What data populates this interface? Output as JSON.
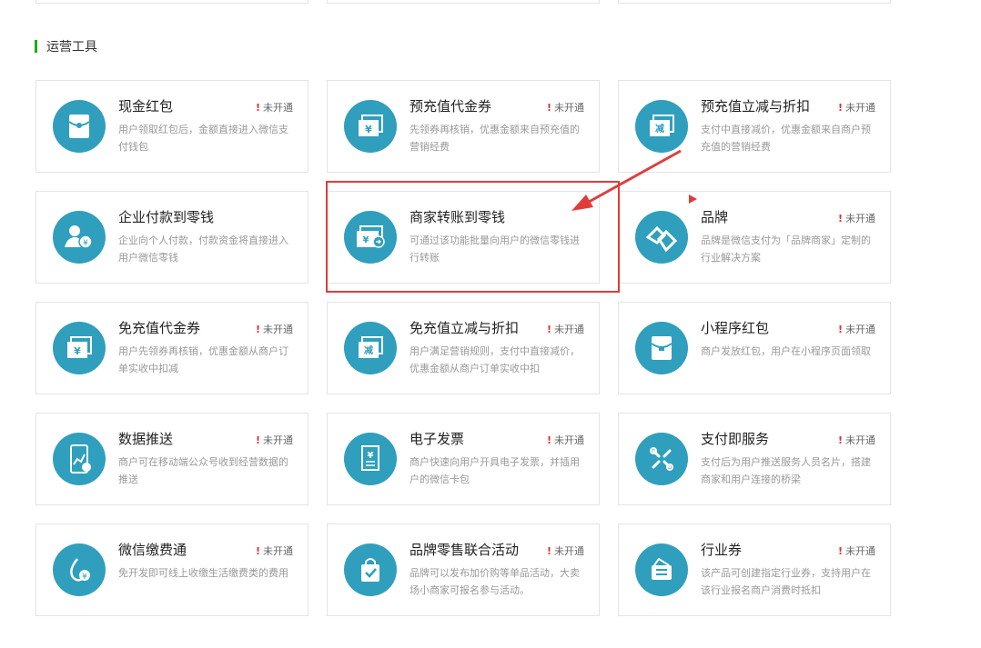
{
  "section": {
    "title": "运营工具"
  },
  "status_label": "未开通",
  "status_mark": "!",
  "colors": {
    "icon_bg": "#2f9fbd",
    "accent_bar": "#1aad19",
    "alert_red": "#e03c3c"
  },
  "cards": [
    {
      "title": "现金红包",
      "desc": "用户领取红包后，金额直接进入微信支付钱包",
      "status": "未开通",
      "icon": "red-packet-icon"
    },
    {
      "title": "预充值代金券",
      "desc": "先领券再核销，优惠金额来自预充值的营销经费",
      "status": "未开通",
      "icon": "voucher-yen-icon"
    },
    {
      "title": "预充值立减与折扣",
      "desc": "支付中直接减价，优惠金额来自商户预充值的营销经费",
      "status": "未开通",
      "icon": "discount-reduce-icon"
    },
    {
      "title": "企业付款到零钱",
      "desc": "企业向个人付款，付款资金将直接进入用户微信零钱",
      "status": "",
      "icon": "enterprise-pay-icon"
    },
    {
      "title": "商家转账到零钱",
      "desc": "可通过该功能批量向用户的微信零钱进行转账",
      "status": "",
      "icon": "merchant-transfer-icon"
    },
    {
      "title": "品牌",
      "desc": "品牌是微信支付为「品牌商家」定制的行业解决方案",
      "status": "未开通",
      "icon": "brand-icon"
    },
    {
      "title": "免充值代金券",
      "desc": "用户先领券再核销，优惠金额从商户订单实收中扣减",
      "status": "未开通",
      "icon": "voucher-yen-icon"
    },
    {
      "title": "免充值立减与折扣",
      "desc": "用户满足营销规则，支付中直接减价，优惠金额从商户订单实收中扣",
      "status": "未开通",
      "icon": "discount-reduce-icon"
    },
    {
      "title": "小程序红包",
      "desc": "商户发放红包，用户在小程序页面领取",
      "status": "未开通",
      "icon": "mini-program-red-packet-icon"
    },
    {
      "title": "数据推送",
      "desc": "商户可在移动端公众号收到经营数据的推送",
      "status": "未开通",
      "icon": "data-push-icon"
    },
    {
      "title": "电子发票",
      "desc": "商户快速向用户开具电子发票，并插用户的微信卡包",
      "status": "未开通",
      "icon": "e-invoice-icon"
    },
    {
      "title": "支付即服务",
      "desc": "支付后为用户推送服务人员名片，搭建商家和用户连接的桥梁",
      "status": "未开通",
      "icon": "pay-service-icon"
    },
    {
      "title": "微信缴费通",
      "desc": "免开发即可线上收缴生活缴费类的费用",
      "status": "未开通",
      "icon": "bill-payment-icon"
    },
    {
      "title": "品牌零售联合活动",
      "desc": "品牌可以发布加价购等单品活动，大卖场小商家可报名参与活动。",
      "status": "未开通",
      "icon": "shopping-bag-check-icon"
    },
    {
      "title": "行业券",
      "desc": "该产品可创建指定行业券，支持用户在该行业报名商户消费时抵扣",
      "status": "未开通",
      "icon": "industry-coupon-icon"
    }
  ]
}
